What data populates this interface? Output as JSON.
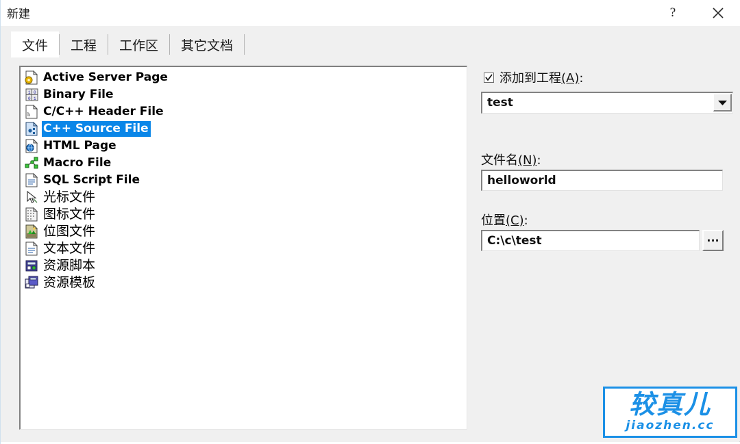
{
  "window": {
    "title": "新建",
    "help_button": "?",
    "close_button": "✕"
  },
  "tabs": [
    {
      "label": "文件",
      "active": true
    },
    {
      "label": "工程",
      "active": false
    },
    {
      "label": "工作区",
      "active": false
    },
    {
      "label": "其它文档",
      "active": false
    }
  ],
  "file_list": {
    "items": [
      {
        "label": "Active Server Page",
        "icon": "asp-page-icon",
        "selected": false,
        "cjk": false
      },
      {
        "label": "Binary File",
        "icon": "binary-file-icon",
        "selected": false,
        "cjk": false
      },
      {
        "label": "C/C++ Header File",
        "icon": "header-file-icon",
        "selected": false,
        "cjk": false
      },
      {
        "label": "C++ Source File",
        "icon": "cpp-source-file-icon",
        "selected": true,
        "cjk": false
      },
      {
        "label": "HTML Page",
        "icon": "html-page-icon",
        "selected": false,
        "cjk": false
      },
      {
        "label": "Macro File",
        "icon": "macro-file-icon",
        "selected": false,
        "cjk": false
      },
      {
        "label": "SQL Script File",
        "icon": "sql-script-file-icon",
        "selected": false,
        "cjk": false
      },
      {
        "label": "光标文件",
        "icon": "cursor-file-icon",
        "selected": false,
        "cjk": true
      },
      {
        "label": "图标文件",
        "icon": "icon-file-icon",
        "selected": false,
        "cjk": true
      },
      {
        "label": "位图文件",
        "icon": "bitmap-file-icon",
        "selected": false,
        "cjk": true
      },
      {
        "label": "文本文件",
        "icon": "text-file-icon",
        "selected": false,
        "cjk": true
      },
      {
        "label": "资源脚本",
        "icon": "resource-script-icon",
        "selected": false,
        "cjk": true
      },
      {
        "label": "资源模板",
        "icon": "resource-template-icon",
        "selected": false,
        "cjk": true
      }
    ]
  },
  "right_panel": {
    "add_to_project": {
      "label_prefix": "添加到工程",
      "accel": "(A)",
      "label_suffix": ":",
      "checked": true
    },
    "project_combo": {
      "value": "test"
    },
    "filename": {
      "label_prefix": "文件名",
      "accel": "(N)",
      "label_suffix": ":",
      "value": "helloworld"
    },
    "location": {
      "label_prefix": "位置",
      "accel": "(C)",
      "label_suffix": ":",
      "value": "C:\\c\\test",
      "browse_label": "..."
    }
  },
  "watermark": {
    "cn": "较真儿",
    "en": "jiaozhen.cc",
    "color": "#1b90e6"
  },
  "colors": {
    "selection_blue": "#0a86e8",
    "dialog_face": "#f0f0f0",
    "field_white": "#ffffff"
  }
}
